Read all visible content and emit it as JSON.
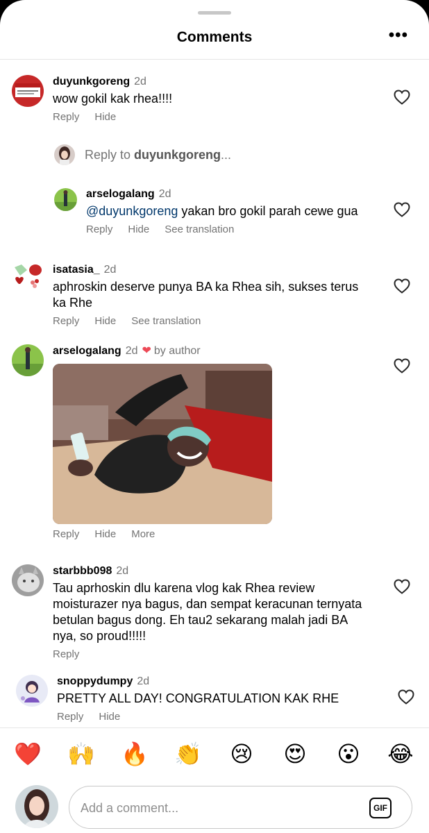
{
  "header": {
    "title": "Comments",
    "more_glyph": "•••",
    "more_icon": "more-horizontal-icon"
  },
  "comments": [
    {
      "username": "duyunkgoreng",
      "time": "2d",
      "text": "wow gokil kak rhea!!!!",
      "actions": [
        "Reply",
        "Hide"
      ]
    },
    {
      "username": "isatasia_",
      "time": "2d",
      "text": "aphroskin deserve punya BA ka Rhea sih, sukses terus ka Rhe",
      "actions": [
        "Reply",
        "Hide",
        "See translation"
      ]
    },
    {
      "username": "arselogalang",
      "time": "2d",
      "badge": "by author",
      "has_photo": true,
      "actions": [
        "Reply",
        "Hide",
        "More"
      ]
    },
    {
      "username": "starbbb098",
      "time": "2d",
      "text": "Tau aprhoskin dlu karena vlog kak Rhea review moisturazer nya bagus, dan sempat keracunan ternyata betulan bagus dong. Eh tau2 sekarang malah jadi BA nya, so proud!!!!!",
      "actions": [
        "Reply"
      ]
    },
    {
      "username": "snoppydumpy",
      "time": "2d",
      "text": "PRETTY ALL DAY! CONGRATULATION KAK RHE",
      "actions": [
        "Reply",
        "Hide"
      ]
    }
  ],
  "reply_composer": {
    "prefix": "Reply to ",
    "target": "duyunkgoreng",
    "suffix": "..."
  },
  "thread_reply": {
    "username": "arselogalang",
    "time": "2d",
    "mention": "@duyunkgoreng",
    "text": " yakan bro gokil parah cewe gua",
    "actions": [
      "Reply",
      "Hide",
      "See translation"
    ]
  },
  "reactions": [
    "❤️",
    "🙌",
    "🔥",
    "👏",
    "😢",
    "😍",
    "😮",
    "😂"
  ],
  "composer": {
    "placeholder": "Add a comment...",
    "gif_label": "GIF"
  },
  "colors": {
    "like_heart": "#ed4956",
    "secondary_text": "#737373",
    "mention": "#00376b"
  }
}
